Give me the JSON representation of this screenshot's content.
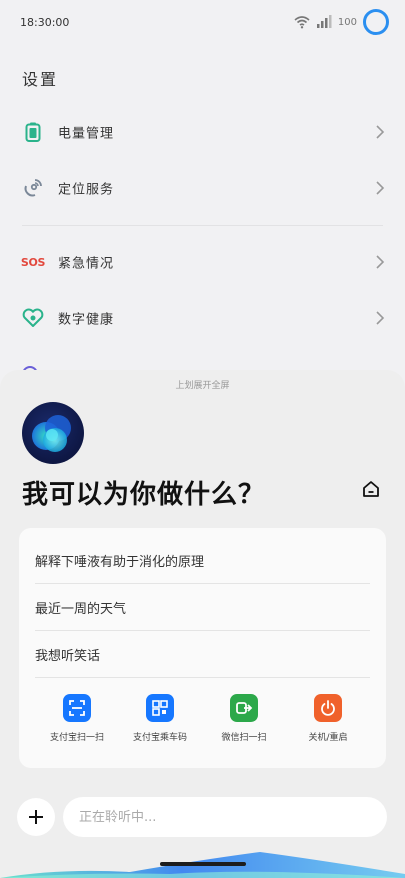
{
  "status_bar": {
    "time": "18:30:00",
    "battery": "100",
    "ring_color": "#2b8ff0"
  },
  "page": {
    "title": "设置"
  },
  "settings": {
    "items": [
      {
        "label": "电量管理",
        "icon": "battery-icon"
      },
      {
        "label": "定位服务",
        "icon": "location-satellite-icon"
      },
      {
        "label": "紧急情况",
        "icon": "sos-icon",
        "icon_text": "SOS"
      },
      {
        "label": "数字健康",
        "icon": "heart-icon"
      }
    ]
  },
  "assistant": {
    "hint": "上划展开全屏",
    "greeting": "我可以为你做什么？",
    "suggestions": [
      "解释下唾液有助于消化的原理",
      "最近一周的天气",
      "我想听笑话"
    ],
    "quick_actions": [
      {
        "label": "支付宝扫一扫",
        "icon": "scan-icon",
        "color": "#1677ff"
      },
      {
        "label": "支付宝乘车码",
        "icon": "bus-code-icon",
        "color": "#1677ff"
      },
      {
        "label": "微信扫一扫",
        "icon": "wechat-scan-icon",
        "color": "#2ca84a"
      },
      {
        "label": "关机/重启",
        "icon": "power-icon",
        "color": "#f0612b"
      }
    ],
    "input": {
      "placeholder": "正在聆听中..."
    }
  },
  "colors": {
    "accent_green": "#2ab38b",
    "sos_red": "#e2483d",
    "sheet_bg": "#eeeeee"
  }
}
